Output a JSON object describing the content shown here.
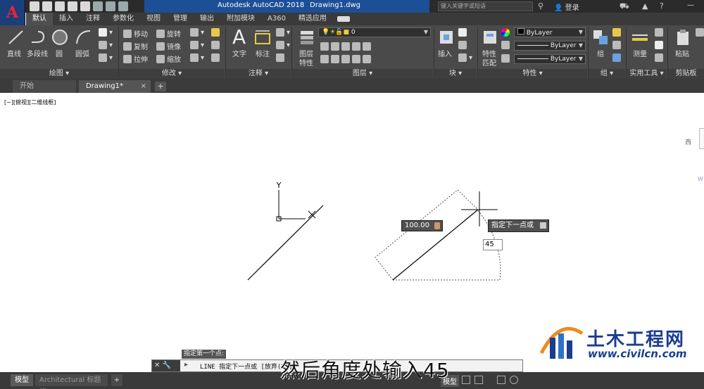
{
  "titlebar": {
    "app_title": "Autodesk AutoCAD 2018",
    "file_name": "Drawing1.dwg",
    "search_placeholder": "键入关键字或短语",
    "login_label": "登录",
    "help_label": "?"
  },
  "ribbon_tabs": [
    "默认",
    "插入",
    "注释",
    "参数化",
    "视图",
    "管理",
    "输出",
    "附加模块",
    "A360",
    "精选应用"
  ],
  "ribbon": {
    "draw": {
      "title": "绘图 ▾",
      "line": "直线",
      "polyline": "多段线",
      "circle": "圆",
      "arc": "圆弧"
    },
    "modify": {
      "title": "修改 ▾",
      "move": "移动",
      "rotate": "旋转",
      "copy": "复制",
      "mirror": "镜像",
      "stretch": "拉伸",
      "scale": "缩放"
    },
    "annotation": {
      "title": "注释 ▾",
      "text": "文字",
      "dimension": "标注"
    },
    "layers": {
      "title": "图层 ▾",
      "layer_props": "图层",
      "layer_props2": "特性",
      "current_layer": "0"
    },
    "block": {
      "title": "块 ▾",
      "insert": "插入"
    },
    "properties": {
      "title": "特性 ▾",
      "match": "特性",
      "match2": "匹配",
      "color": "ByLayer",
      "linetype": "ByLayer",
      "lineweight": "ByLayer"
    },
    "groups": {
      "title": "组 ▾",
      "group": "组"
    },
    "utilities": {
      "title": "实用工具 ▾",
      "measure": "测量"
    },
    "clipboard": {
      "title": "剪贴板",
      "paste": "粘贴"
    }
  },
  "doc_tabs": {
    "start": "开始",
    "drawing": "Drawing1*",
    "close": "×",
    "add": "+"
  },
  "canvas": {
    "viewport_label": "[−][俯视][二维线框]",
    "ucs_y": "Y",
    "viewcube_west": "西",
    "viewcube_wcs": "W",
    "length_tooltip": "100.00",
    "prompt_tooltip": "指定下一点或",
    "angle_input": "45"
  },
  "command": {
    "hint": "指定第一个点:",
    "text": "LINE 指定下一点或 [放弃(U)]:"
  },
  "statusbar": {
    "model_tab": "模型",
    "layout_tab": "Architectural 标题栏",
    "add_tab": "+",
    "model_button": "模型"
  },
  "overlay": {
    "subtitle": "然后角度处输入45",
    "watermark_name": "土木工程网",
    "watermark_url": "www.civilcn.com"
  },
  "colors": {
    "title_blue": "#1c4f96",
    "ribbon_bg": "#4a4a4a",
    "canvas_bg": "#ffffff",
    "watermark_blue": "#1a3e8f"
  }
}
